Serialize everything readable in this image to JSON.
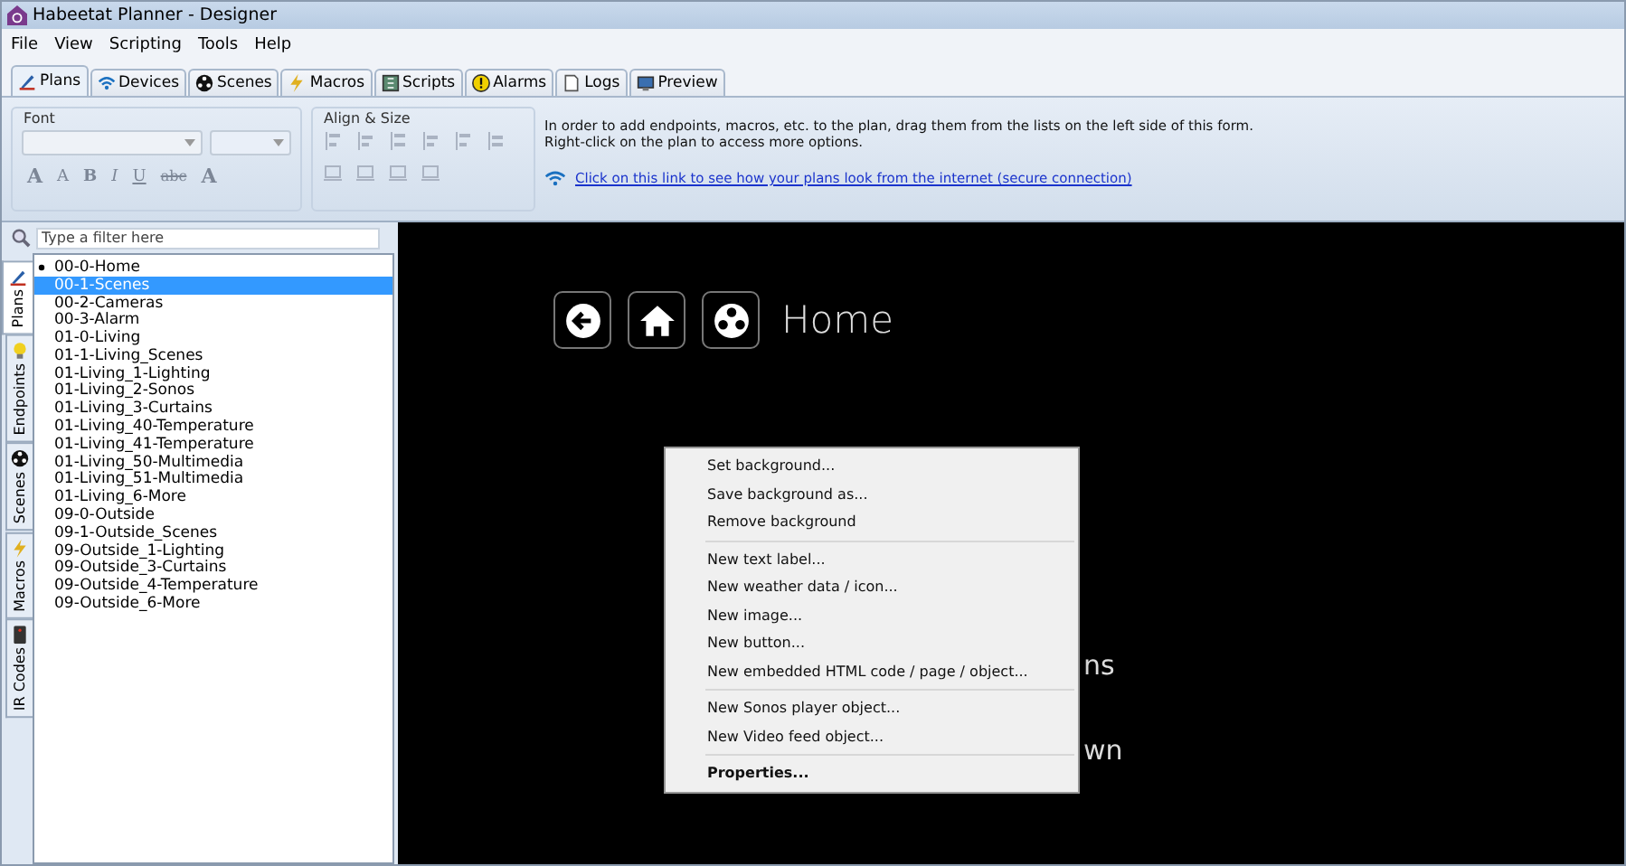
{
  "window": {
    "title": "Habeetat Planner - Designer"
  },
  "menu": [
    "File",
    "View",
    "Scripting",
    "Tools",
    "Help"
  ],
  "tabs": [
    {
      "label": "Plans",
      "selected": true
    },
    {
      "label": "Devices",
      "selected": false
    },
    {
      "label": "Scenes",
      "selected": false
    },
    {
      "label": "Macros",
      "selected": false
    },
    {
      "label": "Scripts",
      "selected": false
    },
    {
      "label": "Alarms",
      "selected": false
    },
    {
      "label": "Logs",
      "selected": false
    },
    {
      "label": "Preview",
      "selected": false
    }
  ],
  "ribbon": {
    "font_group": {
      "title": "Font",
      "disabled": true,
      "format_buttons": [
        "A",
        "A",
        "B",
        "I",
        "U",
        "abc",
        "A"
      ]
    },
    "align_group": {
      "title": "Align & Size",
      "disabled": true
    },
    "info_lines": [
      "In order to add endpoints, macros, etc. to the plan, drag them from the lists on the left side of this form.",
      "Right-click on the plan to access more options."
    ],
    "link": "Click on this link to see how your plans look from the internet (secure connection)"
  },
  "sidebar": {
    "filter": {
      "placeholder": "Type a filter here"
    },
    "side_tabs": [
      {
        "label": "Plans",
        "selected": true
      },
      {
        "label": "Endpoints",
        "selected": false
      },
      {
        "label": "Scenes",
        "selected": false
      },
      {
        "label": "Macros",
        "selected": false
      },
      {
        "label": "IR Codes",
        "selected": false
      }
    ],
    "plans": [
      {
        "label": "00-0-Home",
        "selected": false,
        "current": true
      },
      {
        "label": "00-1-Scenes",
        "selected": true,
        "current": false
      },
      {
        "label": "00-2-Cameras",
        "selected": false,
        "current": false
      },
      {
        "label": "00-3-Alarm",
        "selected": false,
        "current": false
      },
      {
        "label": "01-0-Living",
        "selected": false,
        "current": false
      },
      {
        "label": "01-1-Living_Scenes",
        "selected": false,
        "current": false
      },
      {
        "label": "01-Living_1-Lighting",
        "selected": false,
        "current": false
      },
      {
        "label": "01-Living_2-Sonos",
        "selected": false,
        "current": false
      },
      {
        "label": "01-Living_3-Curtains",
        "selected": false,
        "current": false
      },
      {
        "label": "01-Living_40-Temperature",
        "selected": false,
        "current": false
      },
      {
        "label": "01-Living_41-Temperature",
        "selected": false,
        "current": false
      },
      {
        "label": "01-Living_50-Multimedia",
        "selected": false,
        "current": false
      },
      {
        "label": "01-Living_51-Multimedia",
        "selected": false,
        "current": false
      },
      {
        "label": "01-Living_6-More",
        "selected": false,
        "current": false
      },
      {
        "label": "09-0-Outside",
        "selected": false,
        "current": false
      },
      {
        "label": "09-1-Outside_Scenes",
        "selected": false,
        "current": false
      },
      {
        "label": "09-Outside_1-Lighting",
        "selected": false,
        "current": false
      },
      {
        "label": "09-Outside_3-Curtains",
        "selected": false,
        "current": false
      },
      {
        "label": "09-Outside_4-Temperature",
        "selected": false,
        "current": false
      },
      {
        "label": "09-Outside_6-More",
        "selected": false,
        "current": false
      }
    ]
  },
  "canvas": {
    "title": "Home",
    "texts": [
      "ns",
      "wn"
    ]
  },
  "context_menu": [
    {
      "kind": "item",
      "label": "Set background...",
      "bold": false
    },
    {
      "kind": "item",
      "label": "Save background as...",
      "bold": false
    },
    {
      "kind": "item",
      "label": "Remove background",
      "bold": false
    },
    {
      "kind": "separator"
    },
    {
      "kind": "item",
      "label": "New text label...",
      "bold": false
    },
    {
      "kind": "item",
      "label": "New weather data / icon...",
      "bold": false
    },
    {
      "kind": "item",
      "label": "New image...",
      "bold": false
    },
    {
      "kind": "item",
      "label": "New button...",
      "bold": false
    },
    {
      "kind": "item",
      "label": "New embedded HTML code / page / object...",
      "bold": false
    },
    {
      "kind": "separator"
    },
    {
      "kind": "item",
      "label": "New Sonos player object...",
      "bold": false
    },
    {
      "kind": "item",
      "label": "New Video feed object...",
      "bold": false
    },
    {
      "kind": "separator"
    },
    {
      "kind": "item",
      "label": "Properties...",
      "bold": true
    }
  ]
}
